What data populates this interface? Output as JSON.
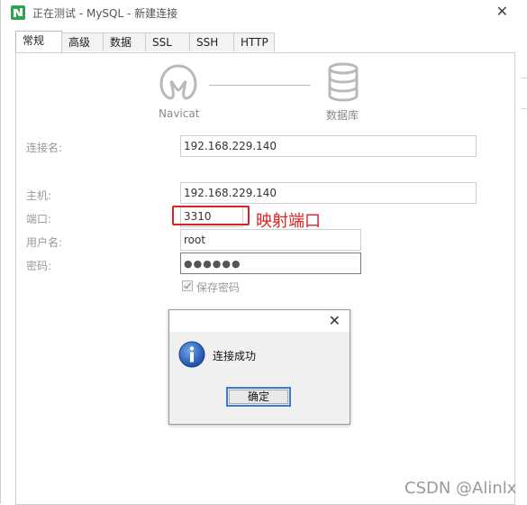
{
  "window": {
    "title": "正在测试 - MySQL - 新建连接"
  },
  "tabs": [
    {
      "label": "常规",
      "active": true
    },
    {
      "label": "高级"
    },
    {
      "label": "数据库"
    },
    {
      "label": "SSL"
    },
    {
      "label": "SSH"
    },
    {
      "label": "HTTP"
    }
  ],
  "hero": {
    "left_label": "Navicat",
    "right_label": "数据库",
    "left_icon": "navicat-logo-icon",
    "right_icon": "database-icon"
  },
  "form": {
    "connection_name_label": "连接名:",
    "connection_name_value": "192.168.229.140",
    "host_label": "主机:",
    "host_value": "192.168.229.140",
    "port_label": "端口:",
    "port_value": "3310",
    "username_label": "用户名:",
    "username_value": "root",
    "password_label": "密码:",
    "password_mask": "●●●●●●",
    "save_password_label": "保存密码",
    "save_password_checked": true
  },
  "annotation": {
    "text": "映射端口",
    "color": "#e02020"
  },
  "dialog": {
    "message": "连接成功",
    "ok_label": "确定",
    "icon": "info-icon"
  },
  "watermark": "CSDN @Alinlx",
  "colors": {
    "accent": "#3b7ad6",
    "annotation_red": "#e02020",
    "app_icon_green": "#2ea44f"
  }
}
